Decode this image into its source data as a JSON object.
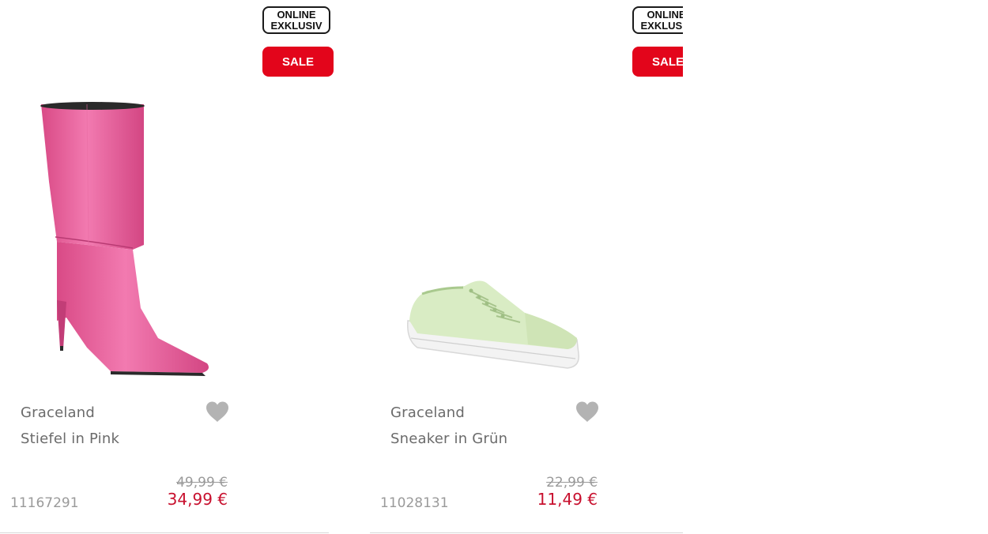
{
  "products": [
    {
      "badge_online_line1": "ONLINE",
      "badge_online_line2": "EXKLUSIV",
      "badge_sale": "SALE",
      "brand": "Graceland",
      "name": "Stiefel in Pink",
      "old_price": "49,99 €",
      "new_price": "34,99 €",
      "article_number": "11167291",
      "image_icon": "pink-boot-image",
      "wishlist_icon": "heart-icon"
    },
    {
      "badge_online_line1": "ONLINE",
      "badge_online_line2": "EXKLUSIV",
      "badge_sale": "SALE",
      "brand": "Graceland",
      "name": "Sneaker in Grün",
      "old_price": "22,99 €",
      "new_price": "11,49 €",
      "article_number": "11028131",
      "image_icon": "green-sneaker-image",
      "wishlist_icon": "heart-icon"
    }
  ],
  "colors": {
    "sale_red": "#e3051b",
    "price_red": "#c8102e",
    "text_gray": "#6b6b6b",
    "muted_gray": "#9a9a9a",
    "heart_gray": "#b3b3b3"
  }
}
